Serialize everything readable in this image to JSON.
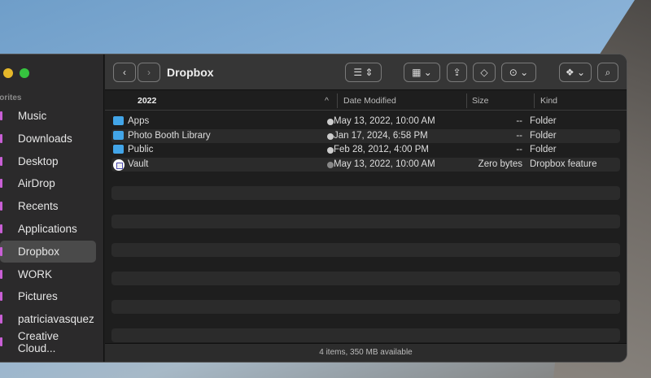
{
  "window": {
    "title": "Dropbox",
    "traffic_colors": {
      "minimize": "#e6b82a",
      "zoom": "#36c43f"
    }
  },
  "sidebar": {
    "section": "Favorites",
    "section_visible": "orites",
    "items": [
      {
        "label": "Music"
      },
      {
        "label": "Downloads"
      },
      {
        "label": "Desktop"
      },
      {
        "label": "AirDrop"
      },
      {
        "label": "Recents"
      },
      {
        "label": "Applications"
      },
      {
        "label": "Dropbox",
        "selected": true
      },
      {
        "label": "WORK"
      },
      {
        "label": "Pictures"
      },
      {
        "label": "patriciavasquez"
      },
      {
        "label": "Creative Cloud..."
      }
    ]
  },
  "columns": {
    "name": "2022",
    "date": "Date Modified",
    "size": "Size",
    "kind": "Kind"
  },
  "files": [
    {
      "name": "Apps",
      "icon": "folder-icon",
      "date": "May 13, 2022, 10:00 AM",
      "size": "--",
      "kind": "Folder"
    },
    {
      "name": "Photo Booth Library",
      "icon": "folder-icon",
      "date": "Jan 17, 2024, 6:58 PM",
      "size": "--",
      "kind": "Folder"
    },
    {
      "name": "Public",
      "icon": "folder-icon",
      "date": "Feb 28, 2012, 4:00 PM",
      "size": "--",
      "kind": "Folder"
    },
    {
      "name": "Vault",
      "icon": "vault-icon",
      "date": "May 13, 2022, 10:00 AM",
      "size": "Zero bytes",
      "kind": "Dropbox feature"
    }
  ],
  "status": "4 items, 350 MB available"
}
